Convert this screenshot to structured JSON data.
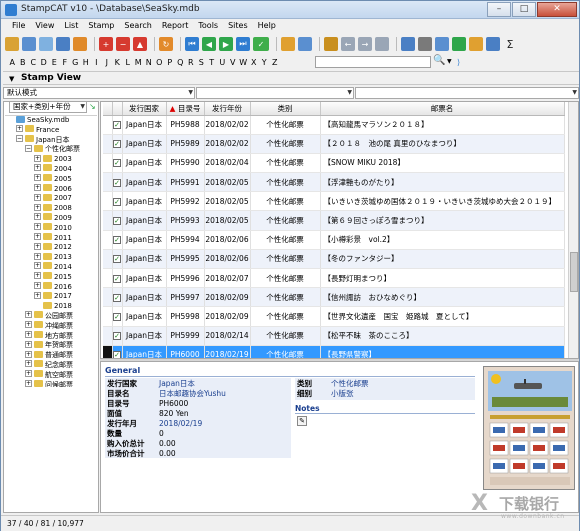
{
  "window": {
    "title": "StampCAT v10 - \\Database\\SeaSky.mdb"
  },
  "menu": [
    "File",
    "View",
    "List",
    "Stamp",
    "Search",
    "Report",
    "Tools",
    "Sites",
    "Help"
  ],
  "alphabet": [
    "A",
    "B",
    "C",
    "D",
    "E",
    "F",
    "G",
    "H",
    "I",
    "J",
    "K",
    "L",
    "M",
    "N",
    "O",
    "P",
    "Q",
    "R",
    "S",
    "T",
    "U",
    "V",
    "W",
    "X",
    "Y",
    "Z"
  ],
  "view": {
    "title": "Stamp View"
  },
  "mode": {
    "selected": "默认模式"
  },
  "left": {
    "combo": "国家+类别+年份"
  },
  "tree": [
    {
      "label": "SeaSky.mdb",
      "level": 0,
      "db": true,
      "exp": ""
    },
    {
      "label": "France",
      "level": 1,
      "exp": "+"
    },
    {
      "label": "Japan日本",
      "level": 1,
      "exp": "−"
    },
    {
      "label": "个性化邮票",
      "level": 2,
      "exp": "−"
    },
    {
      "label": "2003",
      "level": 3,
      "exp": "+"
    },
    {
      "label": "2004",
      "level": 3,
      "exp": "+"
    },
    {
      "label": "2005",
      "level": 3,
      "exp": "+"
    },
    {
      "label": "2006",
      "level": 3,
      "exp": "+"
    },
    {
      "label": "2007",
      "level": 3,
      "exp": "+"
    },
    {
      "label": "2008",
      "level": 3,
      "exp": "+"
    },
    {
      "label": "2009",
      "level": 3,
      "exp": "+"
    },
    {
      "label": "2010",
      "level": 3,
      "exp": "+"
    },
    {
      "label": "2011",
      "level": 3,
      "exp": "+"
    },
    {
      "label": "2012",
      "level": 3,
      "exp": "+"
    },
    {
      "label": "2013",
      "level": 3,
      "exp": "+"
    },
    {
      "label": "2014",
      "level": 3,
      "exp": "+"
    },
    {
      "label": "2015",
      "level": 3,
      "exp": "+"
    },
    {
      "label": "2016",
      "level": 3,
      "exp": "+"
    },
    {
      "label": "2017",
      "level": 3,
      "exp": "+"
    },
    {
      "label": "2018",
      "level": 3,
      "exp": ""
    },
    {
      "label": "公园邮票",
      "level": 2,
      "exp": "+"
    },
    {
      "label": "冲绳邮票",
      "level": 2,
      "exp": "+"
    },
    {
      "label": "地方邮票",
      "level": 2,
      "exp": "+"
    },
    {
      "label": "年贺邮票",
      "level": 2,
      "exp": "+"
    },
    {
      "label": "普通邮票",
      "level": 2,
      "exp": "+"
    },
    {
      "label": "纪念邮票",
      "level": 2,
      "exp": "+"
    },
    {
      "label": "航空邮票",
      "level": 2,
      "exp": "+"
    },
    {
      "label": "问候邮票",
      "level": 2,
      "exp": "+"
    }
  ],
  "grid": {
    "headers": [
      "发行国家",
      "目录号",
      "发行年份",
      "类别",
      "邮票名"
    ],
    "rows": [
      [
        "Japan日本",
        "PH5988",
        "2018/02/02",
        "个性化邮票",
        "【高知龍馬マラソン２０１８】"
      ],
      [
        "Japan日本",
        "PH5989",
        "2018/02/02",
        "个性化邮票",
        "【２０１８　池の尾 真里のひなまつり】"
      ],
      [
        "Japan日本",
        "PH5990",
        "2018/02/04",
        "个性化邮票",
        "【SNOW MIKU 2018】"
      ],
      [
        "Japan日本",
        "PH5991",
        "2018/02/05",
        "个性化邮票",
        "【浮津艶ものがたり】"
      ],
      [
        "Japan日本",
        "PH5992",
        "2018/02/05",
        "个性化邮票",
        "【いきいき茨城ゆめ国体２０１９・いきいき茨城ゆめ大会２０１９】"
      ],
      [
        "Japan日本",
        "PH5993",
        "2018/02/05",
        "个性化邮票",
        "【第６９回さっぽろ雪まつり】"
      ],
      [
        "Japan日本",
        "PH5994",
        "2018/02/06",
        "个性化邮票",
        "【小樽彩景　vol.2】"
      ],
      [
        "Japan日本",
        "PH5995",
        "2018/02/06",
        "个性化邮票",
        "【冬のファンタジー】"
      ],
      [
        "Japan日本",
        "PH5996",
        "2018/02/07",
        "个性化邮票",
        "【長野灯明まつり】"
      ],
      [
        "Japan日本",
        "PH5997",
        "2018/02/09",
        "个性化邮票",
        "【信州諏訪　おひなめぐり】"
      ],
      [
        "Japan日本",
        "PH5998",
        "2018/02/09",
        "个性化邮票",
        "【世界文化遺産　国宝　姫路城　夏として】"
      ],
      [
        "Japan日本",
        "PH5999",
        "2018/02/14",
        "个性化邮票",
        "【松平不昧　茶のこころ】"
      ],
      [
        "Japan日本",
        "PH6000",
        "2018/02/19",
        "个性化邮票",
        "【長野県警察】"
      ]
    ]
  },
  "details": {
    "section": "General",
    "fields": [
      {
        "k": "发行国家",
        "v": "Japan日本"
      },
      {
        "k": "目录名",
        "v": "日本邮趣协会Yushu"
      },
      {
        "k": "目录号",
        "v": "PH6000"
      },
      {
        "k": "面值",
        "v": "820 Yen"
      },
      {
        "k": "发行年月",
        "v": "2018/02/19"
      },
      {
        "k": "数量",
        "v": "0"
      },
      {
        "k": "购入价总计",
        "v": "0.00"
      },
      {
        "k": "市场价合计",
        "v": "0.00"
      }
    ],
    "right_fields": [
      {
        "k": "类别",
        "v": "个性化邮票"
      },
      {
        "k": "细别",
        "v": "小版张"
      }
    ],
    "notes": "Notes"
  },
  "status": {
    "text": "37 / 40 / 81 / 10,977"
  },
  "watermark": {
    "logo": "X",
    "text": "下载银行",
    "url": "www.downbank.cn"
  },
  "colors": {
    "accent": "#3399ff",
    "link": "#1a3f8f"
  }
}
